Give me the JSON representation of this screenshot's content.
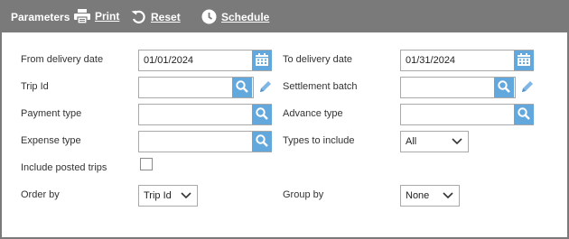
{
  "toolbar": {
    "title": "Parameters",
    "print_label": "Print",
    "reset_label": "Reset",
    "schedule_label": "Schedule"
  },
  "form": {
    "from_delivery_date": {
      "label": "From delivery date",
      "value": "01/01/2024"
    },
    "to_delivery_date": {
      "label": "To delivery date",
      "value": "01/31/2024"
    },
    "trip_id": {
      "label": "Trip Id",
      "value": ""
    },
    "settlement_batch": {
      "label": "Settlement batch",
      "value": ""
    },
    "payment_type": {
      "label": "Payment type",
      "value": ""
    },
    "advance_type": {
      "label": "Advance type",
      "value": ""
    },
    "expense_type": {
      "label": "Expense type",
      "value": ""
    },
    "types_to_include": {
      "label": "Types to include",
      "value": "All"
    },
    "include_posted_trips": {
      "label": "Include posted trips",
      "checked": false
    },
    "order_by": {
      "label": "Order by",
      "value": "Trip Id"
    },
    "group_by": {
      "label": "Group by",
      "value": "None"
    }
  },
  "colors": {
    "toolbar_bg": "#7a7a7a",
    "accent_button": "#63a8dd",
    "pencil": "#7fb6e3"
  },
  "icons": {
    "print": "printer-icon",
    "reset": "undo-icon",
    "schedule": "clock-icon",
    "calendar": "calendar-icon",
    "search": "search-icon",
    "edit": "pencil-icon",
    "dropdown": "chevron-down-icon"
  }
}
